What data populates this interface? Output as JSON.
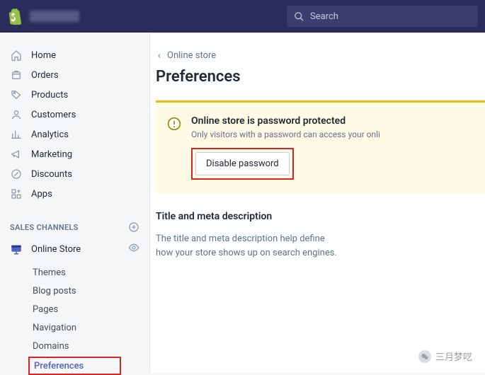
{
  "header": {
    "search_placeholder": "Search"
  },
  "nav": {
    "home": "Home",
    "orders": "Orders",
    "products": "Products",
    "customers": "Customers",
    "analytics": "Analytics",
    "marketing": "Marketing",
    "discounts": "Discounts",
    "apps": "Apps"
  },
  "channels": {
    "title": "SALES CHANNELS",
    "online_store": "Online Store",
    "sub": {
      "themes": "Themes",
      "blog": "Blog posts",
      "pages": "Pages",
      "navigation": "Navigation",
      "domains": "Domains",
      "preferences": "Preferences"
    }
  },
  "main": {
    "crumb": "Online store",
    "title": "Preferences",
    "notice_title": "Online store is password protected",
    "notice_sub": "Only visitors with a password can access your onli",
    "disable_btn": "Disable password",
    "sec2_title": "Title and meta description",
    "sec2_desc": "The title and meta description help define how your store shows up on search engines."
  },
  "watermark": "三月梦呓"
}
